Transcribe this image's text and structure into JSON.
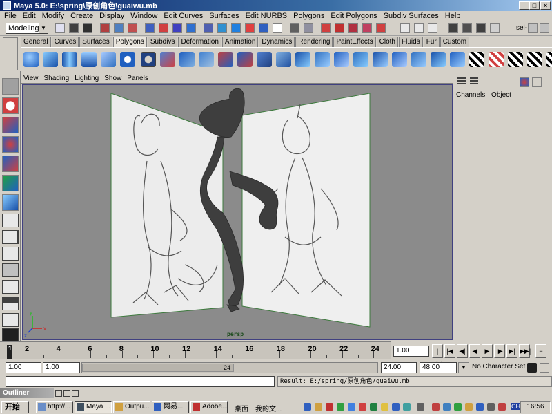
{
  "window": {
    "title": "Maya 5.0: E:\\spring\\原创角色\\guaiwu.mb"
  },
  "menu": [
    "File",
    "Edit",
    "Modify",
    "Create",
    "Display",
    "Window",
    "Edit Curves",
    "Surfaces",
    "Edit NURBS",
    "Polygons",
    "Edit Polygons",
    "Subdiv Surfaces",
    "Help"
  ],
  "status_line": {
    "mode": "Modeling",
    "sel_label": "sel-"
  },
  "shelf_tabs": [
    "General",
    "Curves",
    "Surfaces",
    "Polygons",
    "Subdivs",
    "Deformation",
    "Animation",
    "Dynamics",
    "Rendering",
    "PaintEffects",
    "Cloth",
    "Fluids",
    "Fur",
    "Custom"
  ],
  "shelf_active_tab": "Polygons",
  "panel_menu": [
    "View",
    "Shading",
    "Lighting",
    "Show",
    "Panels"
  ],
  "viewport": {
    "camera_label": "persp",
    "axis": {
      "x": "x",
      "y": "y",
      "z": "z"
    }
  },
  "channel_box": {
    "channels": "Channels",
    "object": "Object"
  },
  "timeline": {
    "ticks": [
      "2",
      "4",
      "6",
      "8",
      "10",
      "12",
      "14",
      "16",
      "18",
      "20",
      "22",
      "24"
    ],
    "current_frame": "1.00",
    "marker": "1"
  },
  "range": {
    "start": "1.00",
    "playback_start": "1.00",
    "range_label": "24",
    "playback_end": "24.00",
    "end": "48.00",
    "character_set": "No Character Set"
  },
  "command_line": {
    "result": "Result: E:/spring/原创角色/guaiwu.mb"
  },
  "outliner": {
    "title": "Outliner"
  },
  "taskbar": {
    "start": "开始",
    "tasks": [
      "http://...",
      "Maya ...",
      "Outpu...",
      "网易...",
      "Adobe...",
      "桌面",
      "我的文..."
    ],
    "clock": "16:56",
    "ime": "CH"
  },
  "colors": {
    "viewport_bg": "#8b8b8b",
    "model": "#3e3e3e",
    "title_blue": "#0a246a"
  }
}
